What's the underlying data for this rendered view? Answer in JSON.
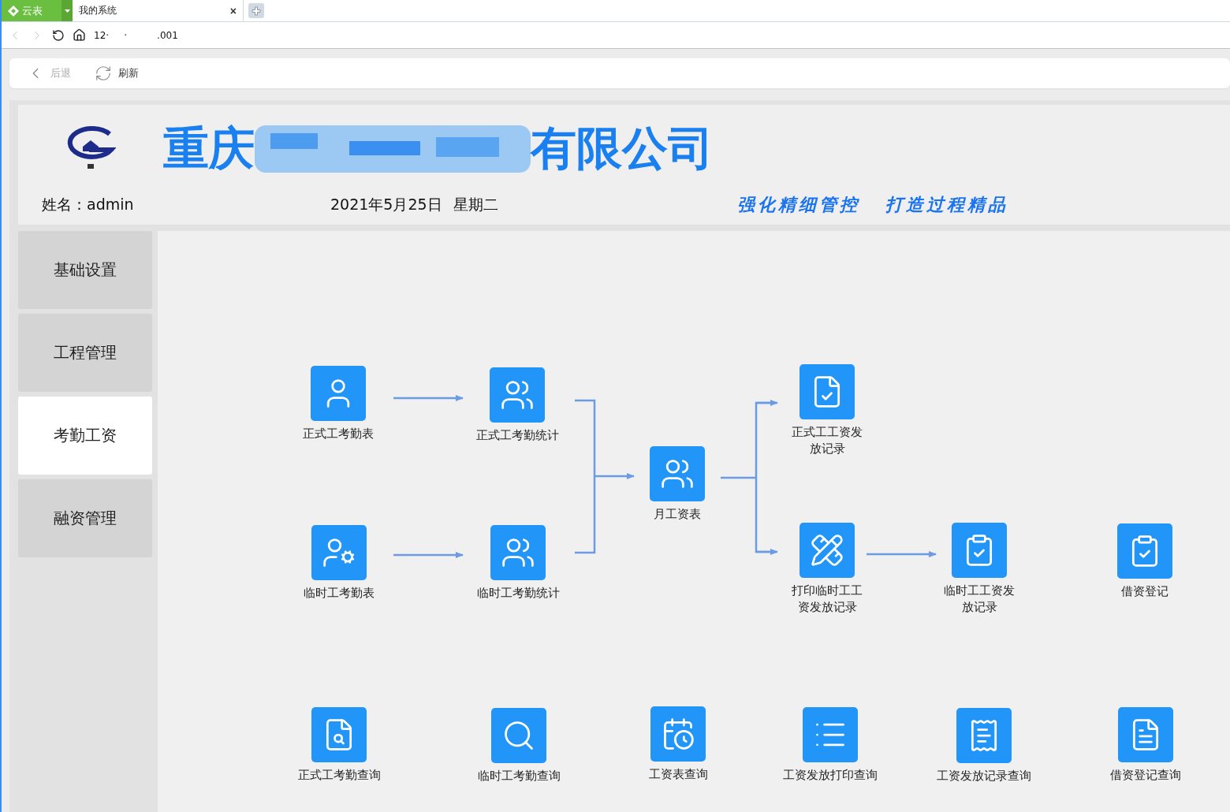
{
  "browser": {
    "app_button": "云表",
    "tab": {
      "title": "我的系统",
      "close": "×"
    },
    "address": "12·     ·          .001"
  },
  "toolbar": {
    "back": {
      "label": "后退",
      "disabled": true
    },
    "refresh": {
      "label": "刷新"
    }
  },
  "header": {
    "company_name_start": "重庆",
    "company_name_end": "有限公司",
    "user_label": "姓名：admin",
    "date": "2021年5月25日",
    "weekday": "星期二",
    "slogans": [
      "强化精细管控",
      "打造过程精品"
    ]
  },
  "sidebar": {
    "items": [
      {
        "label": "基础设置",
        "selected": false
      },
      {
        "label": "工程管理",
        "selected": false
      },
      {
        "label": "考勤工资",
        "selected": true
      },
      {
        "label": "融资管理",
        "selected": false
      }
    ]
  },
  "flow": {
    "nodes": [
      {
        "lines": [
          "正式工考勤表"
        ]
      },
      {
        "lines": [
          "正式工考勤统计"
        ]
      },
      {
        "lines": [
          "临时工考勤表"
        ]
      },
      {
        "lines": [
          "临时工考勤统计"
        ]
      },
      {
        "lines": [
          "月工资表"
        ]
      },
      {
        "lines": [
          "正式工工资发",
          "放记录"
        ]
      },
      {
        "lines": [
          "打印临时工工",
          "资发放记录"
        ]
      },
      {
        "lines": [
          "临时工工资发",
          "放记录"
        ]
      },
      {
        "lines": [
          "借资登记"
        ]
      }
    ],
    "queries": [
      {
        "label": "正式工考勤查询"
      },
      {
        "label": "临时工考勤查询"
      },
      {
        "label": "工资表查询"
      },
      {
        "label": "工资发放打印查询"
      },
      {
        "label": "工资发放记录查询"
      },
      {
        "label": "借资登记查询"
      }
    ]
  }
}
